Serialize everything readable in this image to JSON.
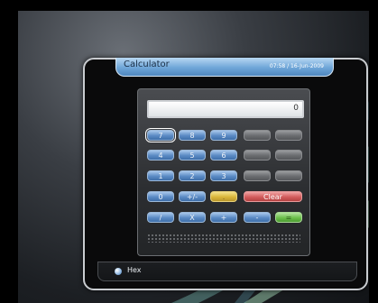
{
  "window": {
    "title": "Calculator",
    "datetime": "07:58 / 16-Jun-2009"
  },
  "display": {
    "value": "0"
  },
  "keys": {
    "k7": "7",
    "k8": "8",
    "k9": "9",
    "k4": "4",
    "k5": "5",
    "k6": "6",
    "k1": "1",
    "k2": "2",
    "k3": "3",
    "k0": "0",
    "sign": "+/-",
    "dot": ".",
    "clear": "Clear",
    "divide": "/",
    "multiply": "X",
    "add": "+",
    "subtract": "-",
    "equals": "="
  },
  "status": {
    "mode_label": "Hex"
  },
  "colors": {
    "blue_key": "#5a8ac4",
    "gray_key": "#6a6c6f",
    "yellow_key": "#d9b63a",
    "red_key": "#d25c5c",
    "green_key": "#6cc04b",
    "title_bar": "#6fa6d8"
  }
}
